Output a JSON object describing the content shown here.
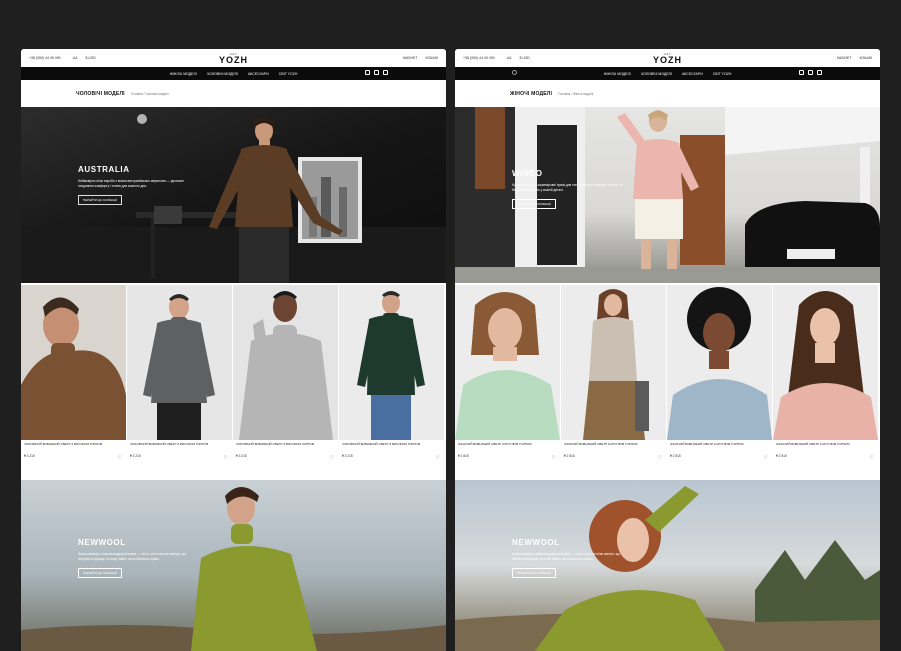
{
  "men": {
    "topbar": {
      "phone": "+38 (050) 44 49 490",
      "lang": "UA",
      "currency": "$ USD",
      "logo_sub": "GET",
      "logo": "YOZH",
      "link1": "КАБІНЕТ",
      "link2": "КОШИК"
    },
    "nav": [
      "ЖІНОЧІ МОДЕЛІ",
      "ЧОЛОВІЧІ МОДЕЛІ",
      "АКСЕСУАРИ",
      "СВІТ YOZH"
    ],
    "page_title": "ЧОЛОВІЧІ МОДЕЛІ",
    "breadcrumb": "Головна  /  Чоловічі моделі",
    "hero": {
      "title": "AUSTRALIA",
      "text": "Неймовірно м’які вироби з вовни австралійських мериносів — ідеальне поєднання комфорту і стилю для кожного дня.",
      "button": "ПЕРЕЙТИ ДО КОЛЕКЦІЇ"
    },
    "products": [
      {
        "name": "ЧОЛОВІЧИЙ ВОВНЯНИЙ СВЕТР З ВИСОКИМ ГОРЛОМ",
        "price": "₴ 3 215"
      },
      {
        "name": "ЧОЛОВІЧИЙ ВОВНЯНИЙ СВЕТР З ВИСОКИМ ГОРЛОМ",
        "price": "₴ 3 215"
      },
      {
        "name": "ЧОЛОВІЧИЙ ВОВНЯНИЙ СВЕТР З ВИСОКИМ ГОРЛОМ",
        "price": "₴ 3 215"
      },
      {
        "name": "ЧОЛОВІЧИЙ ВОВНЯНИЙ СВЕТР З ВИСОКИМ ГОРЛОМ",
        "price": "₴ 3 215"
      }
    ],
    "promo": {
      "title": "NEWWOOL",
      "text": "Нова колекція з новозеландської вовни — теплі, легкі та м’які светри, що зберігають форму та колір навіть після багатьох прань.",
      "button": "ПЕРЕЙТИ ДО КОЛЕКЦІЇ"
    }
  },
  "women": {
    "topbar": {
      "phone": "+38 (050) 44 49 490",
      "lang": "UA",
      "currency": "$ USD",
      "logo_sub": "GET",
      "logo": "YOZH",
      "link1": "КАБІНЕТ",
      "link2": "КОШИК"
    },
    "nav": [
      "ЖІНОЧІ МОДЕЛІ",
      "ЧОЛОВІЧІ МОДЕЛІ",
      "АКСЕСУАРИ",
      "СВІТ YOZH"
    ],
    "page_title": "ЖІНОЧІ МОДЕЛІ",
    "breadcrumb": "Головна  /  Жіночі моделі",
    "hero": {
      "title": "WINCO",
      "text": "Колекція з м’якої кашемірової пряжі для тих, хто цінує комфорт, легкість та бездоганний стиль у кожній деталі.",
      "button": "ПЕРЕЙТИ ДО КОЛЕКЦІЇ"
    },
    "products": [
      {
        "name": "ЖІНОЧИЙ ВОВНЯНИЙ СВЕТР З КРУГЛИМ ГОРЛОМ",
        "price": "₴ 2 815"
      },
      {
        "name": "ЖІНОЧИЙ ВОВНЯНИЙ СВЕТР З КРУГЛИМ ГОРЛОМ",
        "price": "₴ 2 815"
      },
      {
        "name": "ЖІНОЧИЙ ВОВНЯНИЙ СВЕТР З КРУГЛИМ ГОРЛОМ",
        "price": "₴ 2 815"
      },
      {
        "name": "ЖІНОЧИЙ ВОВНЯНИЙ СВЕТР З КРУГЛИМ ГОРЛОМ",
        "price": "₴ 2 815"
      }
    ],
    "promo": {
      "title": "NEWWOOL",
      "text": "Нова колекція з новозеландської вовни — теплі, легкі та м’які светри, що зберігають форму та колір навіть після багатьох прань.",
      "button": "ПЕРЕЙТИ ДО КОЛЕКЦІЇ"
    }
  },
  "colors": {
    "backdrop": "#1f1f1f",
    "navbar": "#0b0b0b",
    "men_sweaters": [
      "#6b4a30",
      "#5e6062",
      "#b5b5b5",
      "#1e3a2e"
    ],
    "women_sweaters": [
      "#b8dcc0",
      "#c9bfb3",
      "#9fb5c8",
      "#e9b2a8"
    ],
    "promo_sweater": "#8a9a2f"
  },
  "icons": [
    "search-icon",
    "heart-icon",
    "user-icon",
    "cart-icon"
  ]
}
